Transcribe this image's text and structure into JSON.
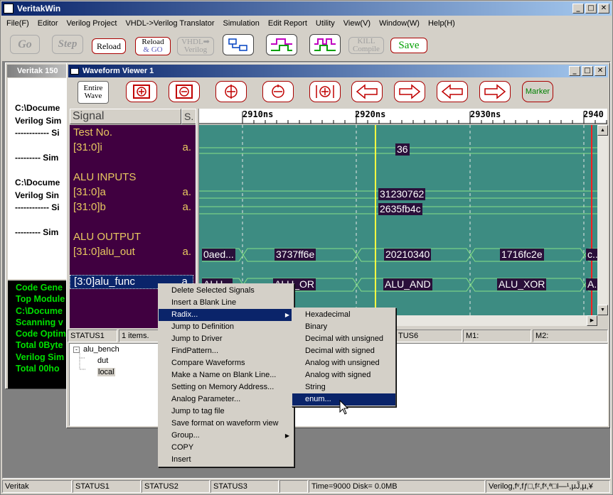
{
  "app": {
    "title": "VeritakWin"
  },
  "menubar": [
    "File(F)",
    "Editor",
    "Verilog Project",
    "VHDL->Verilog Translator",
    "Simulation",
    "Edit Report",
    "Utility",
    "View(V)",
    "Window(W)",
    "Help(H)"
  ],
  "toolbar": {
    "go": "Go",
    "step": "Step",
    "reload": "Reload",
    "reload_go_1": "Reload",
    "reload_go_2": "& GO",
    "vhdl_1": "VHDL➡",
    "vhdl_2": "Verilog",
    "kill_1": "KILL",
    "kill_2": "Compile",
    "save": "Save"
  },
  "console_window": {
    "title": "Veritak 150",
    "lines": [
      "C:\\Docume",
      "Verilog Sim",
      "------------ Si",
      "",
      "--------- Sim",
      "",
      "C:\\Docume",
      "Verilog Sin",
      "------------ Si",
      "",
      "--------- Sim"
    ]
  },
  "green_console": {
    "lines": [
      "Code Gene",
      "Top Module",
      "C:\\Docume",
      "Scanning v",
      "Code Optim",
      "Total 0Byte",
      "Verilog Sim",
      "Total 00ho"
    ]
  },
  "waveform": {
    "title": "Waveform Viewer 1",
    "toolbar": {
      "entire_1": "Entire",
      "entire_2": "Wave",
      "marker": "Marker"
    },
    "signal_header": "Signal",
    "radix_header": "S.",
    "time_ticks": [
      "2910ns",
      "2920ns",
      "2930ns",
      "2940"
    ],
    "signals": [
      {
        "name": "Test No.",
        "radix": ""
      },
      {
        "name": "[31:0]i",
        "radix": "a."
      },
      {
        "name": "",
        "radix": ""
      },
      {
        "name": "ALU INPUTS",
        "radix": ""
      },
      {
        "name": "[31:0]a",
        "radix": "a."
      },
      {
        "name": "[31:0]b",
        "radix": "a."
      },
      {
        "name": "",
        "radix": ""
      },
      {
        "name": " ALU OUTPUT",
        "radix": ""
      },
      {
        "name": "[31:0]alu_out",
        "radix": "a."
      },
      {
        "name": "",
        "radix": ""
      },
      {
        "name": "[3:0]alu_func",
        "radix": "a."
      }
    ],
    "values": {
      "i": "36",
      "a": "31230762",
      "b": "2635fb4c",
      "alu_out": [
        "0aed...",
        "3737ff6e",
        "20210340",
        "1716fc2e",
        "c.."
      ],
      "alu_func": [
        "ALU...",
        "ALU_OR",
        "ALU_AND",
        "ALU_XOR",
        "A..."
      ]
    },
    "status": [
      "STATUS1",
      "1 items.",
      "",
      "",
      "TUS6",
      "M1:",
      "M2:"
    ]
  },
  "tree": {
    "root": "alu_bench",
    "children": [
      "dut",
      "local"
    ]
  },
  "context_menu": [
    "Delete Selected Signals",
    "Insert a Blank Line",
    "Radix...",
    "Jump to Definition",
    "Jump to Driver",
    "FindPattern...",
    "Compare Waveforms",
    "Make a Name on Blank Line...",
    "Setting on Memory Address...",
    "Analog Parameter...",
    "Jump to tag file",
    "Save format on waveform view",
    "Group...",
    "COPY",
    "Insert"
  ],
  "radix_submenu": [
    "Hexadecimal",
    "Binary",
    "Decimal with unsigned",
    "Decimal with signed",
    "Analog with unsigned",
    "Analog with signed",
    "String",
    "enum..."
  ],
  "statusbar": [
    "Veritak",
    "STATUS1",
    "STATUS2",
    "STATUS3",
    "",
    "Time=9000 Disk= 0.0MB",
    "Verilog,fᵛ,fƒ□,fᶻ,fˣ,ª□I—¹,µJ̃,µ,¥"
  ]
}
